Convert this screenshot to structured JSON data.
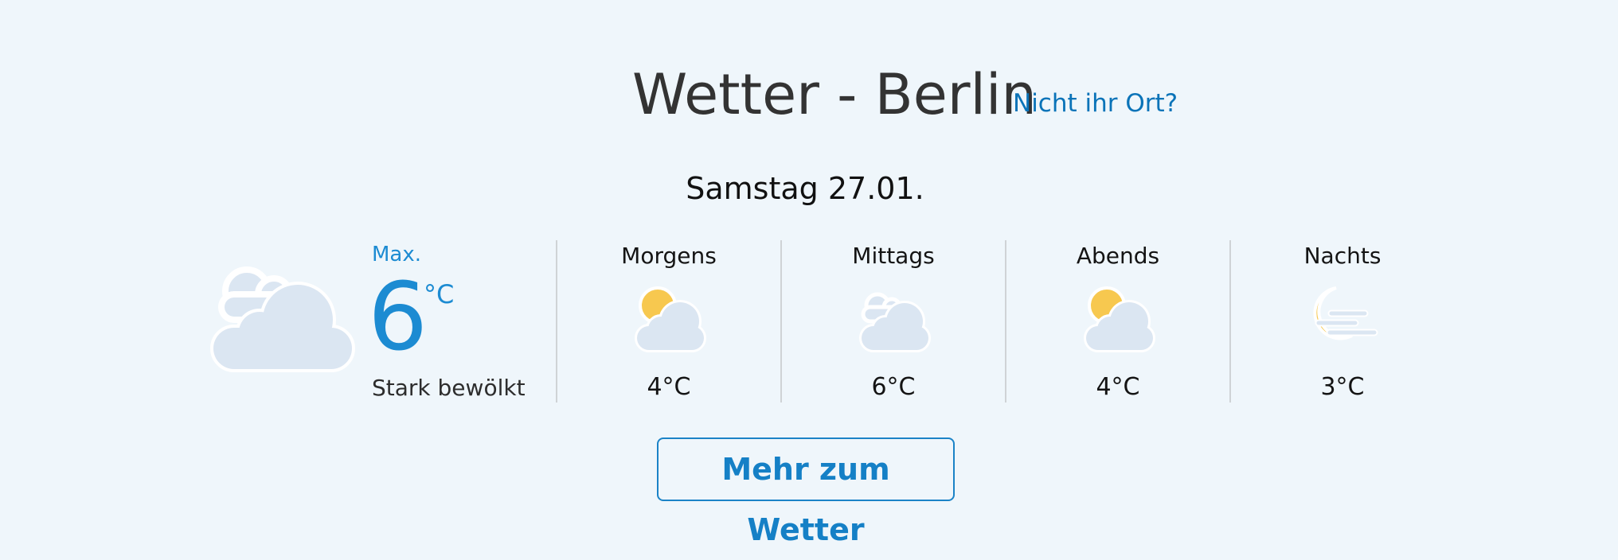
{
  "header": {
    "title": "Wetter - Berlin",
    "location_link": "Nicht ihr Ort?"
  },
  "date": "Samstag 27.01.",
  "current": {
    "icon": "cloudy-icon",
    "max_label": "Max.",
    "max_temp": "6",
    "unit": "°C",
    "description": "Stark bewölkt"
  },
  "periods": [
    {
      "label": "Morgens",
      "icon": "partly-cloudy-icon",
      "temp": "4°C"
    },
    {
      "label": "Mittags",
      "icon": "cloudy-icon",
      "temp": "6°C"
    },
    {
      "label": "Abends",
      "icon": "partly-cloudy-icon",
      "temp": "4°C"
    },
    {
      "label": "Nachts",
      "icon": "moon-fog-icon",
      "temp": "3°C"
    }
  ],
  "more_button": "Mehr zum Wetter",
  "colors": {
    "background": "#eff6fb",
    "accent": "#1c8bd2",
    "link": "#0a73b8",
    "sun": "#f7c84f",
    "cloud": "#dbe6f2"
  }
}
